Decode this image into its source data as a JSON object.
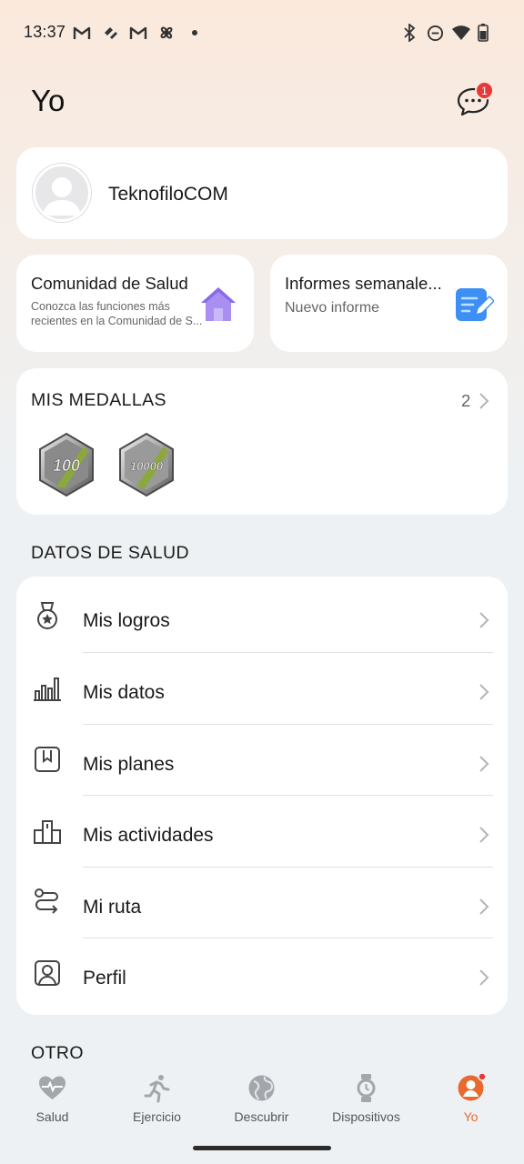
{
  "status_bar": {
    "time": "13:37",
    "left_icons": [
      "gmail-icon",
      "health-icon",
      "gmail-icon",
      "fan-icon",
      "dot-icon"
    ],
    "right_icons": [
      "bluetooth-icon",
      "do-not-disturb-icon",
      "wifi-icon",
      "battery-icon"
    ]
  },
  "header": {
    "title": "Yo",
    "messages_badge": "1"
  },
  "profile": {
    "name": "TeknofiloCOM"
  },
  "community": {
    "title": "Comunidad de Salud",
    "subtitle_line1": "Conozca las funciones más",
    "subtitle_line2": "recientes en la Comunidad de S..."
  },
  "reports": {
    "title": "Informes semanale...",
    "subtitle": "Nuevo informe"
  },
  "medals": {
    "title": "MIS MEDALLAS",
    "count": "2",
    "items": [
      {
        "label": "100"
      },
      {
        "label": "10000"
      }
    ]
  },
  "health_section": {
    "title": "DATOS DE SALUD",
    "items": [
      {
        "label": "Mis logros",
        "icon": "medal-icon"
      },
      {
        "label": "Mis datos",
        "icon": "bar-chart-icon"
      },
      {
        "label": "Mis planes",
        "icon": "plan-icon"
      },
      {
        "label": "Mis actividades",
        "icon": "podium-icon"
      },
      {
        "label": "Mi ruta",
        "icon": "route-icon"
      },
      {
        "label": "Perfil",
        "icon": "profile-icon"
      }
    ]
  },
  "other_section": {
    "title": "OTRO"
  },
  "bottom_nav": {
    "items": [
      {
        "label": "Salud",
        "icon": "heart-icon",
        "active": false
      },
      {
        "label": "Ejercicio",
        "icon": "running-icon",
        "active": false
      },
      {
        "label": "Descubrir",
        "icon": "globe-icon",
        "active": false
      },
      {
        "label": "Dispositivos",
        "icon": "watch-icon",
        "active": false
      },
      {
        "label": "Yo",
        "icon": "user-icon",
        "active": true
      }
    ]
  },
  "colors": {
    "accent": "#e86a2f",
    "badge": "#e5393a",
    "card": "#ffffff",
    "background": "#eef1f3"
  }
}
